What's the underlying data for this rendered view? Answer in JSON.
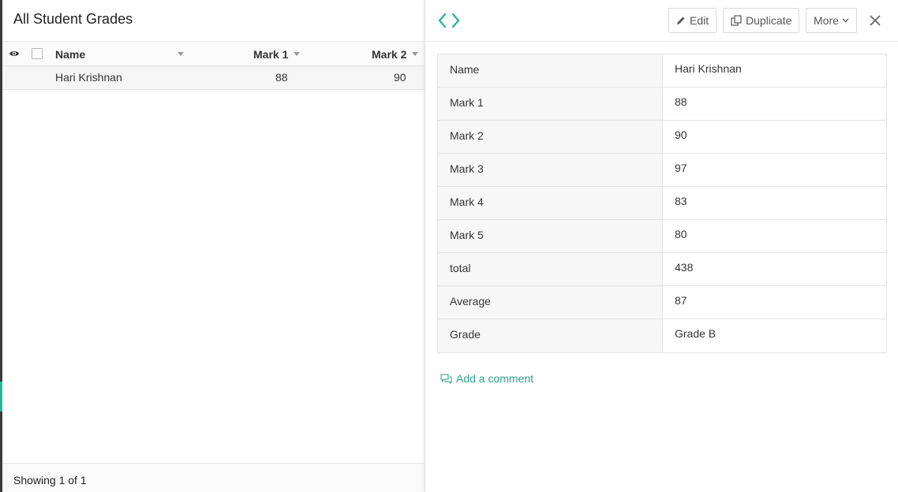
{
  "list": {
    "title": "All Student Grades",
    "columns": {
      "name": "Name",
      "mark1": "Mark 1",
      "mark2": "Mark 2"
    },
    "rows": [
      {
        "name": "Hari Krishnan",
        "mark1": "88",
        "mark2": "90"
      }
    ],
    "footer": "Showing 1 of 1"
  },
  "toolbar": {
    "edit_label": "Edit",
    "duplicate_label": "Duplicate",
    "more_label": "More"
  },
  "details": [
    {
      "label": "Name",
      "value": "Hari Krishnan"
    },
    {
      "label": "Mark 1",
      "value": "88"
    },
    {
      "label": "Mark 2",
      "value": "90"
    },
    {
      "label": "Mark 3",
      "value": "97"
    },
    {
      "label": "Mark 4",
      "value": "83"
    },
    {
      "label": "Mark 5",
      "value": "80"
    },
    {
      "label": "total",
      "value": "438"
    },
    {
      "label": "Average",
      "value": "87"
    },
    {
      "label": "Grade",
      "value": "Grade B"
    }
  ],
  "comment_label": "Add a comment",
  "colors": {
    "accent": "#2bb597",
    "link": "#2ba387"
  },
  "icons": [
    "eye-icon",
    "code-icon",
    "pencil-icon",
    "duplicate-icon",
    "chevron-down-icon",
    "close-icon",
    "comment-icon"
  ]
}
